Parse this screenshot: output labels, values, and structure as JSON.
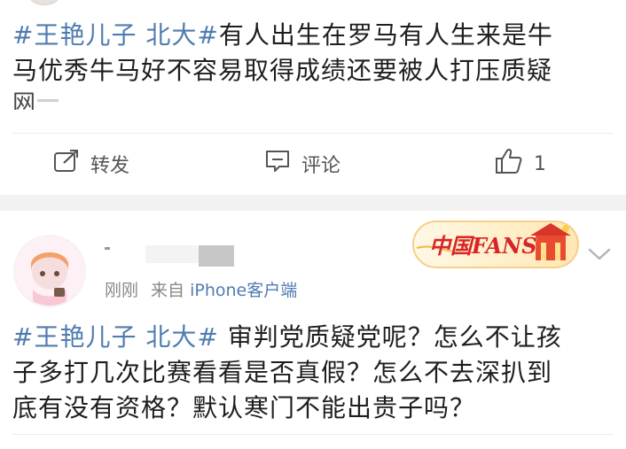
{
  "post_top": {
    "hashtag": "#王艳儿子 北大#",
    "line1_rest": "有人出生在罗马有人生来是牛",
    "line2": "马优秀牛马好不容易取得成绩还要被人打压质疑",
    "line3_cut": "网"
  },
  "actions": {
    "repost_label": "转发",
    "comment_label": "评论",
    "like_count": "1",
    "repost_icon": "repost-icon",
    "comment_icon": "comment-icon",
    "like_icon": "thumbs-up-icon"
  },
  "post_second": {
    "badge_text": "中国FANS",
    "meta_time": "刚刚",
    "meta_from": "来自",
    "meta_source": "iPhone客户端",
    "hashtag": "#王艳儿子 北大#",
    "line1_rest": " 审判党质疑党呢？怎么不让孩",
    "line2": "子多打几次比赛看看是否真假？怎么不去深扒到",
    "line3": "底有没有资格？默认寒门不能出贵子吗？"
  },
  "colors": {
    "link_blue": "#4f7cb0",
    "text_dark": "#1e1e1e",
    "meta_gray": "#8a8a8a",
    "separator_band": "#f2f2f2",
    "badge_red": "#d8232a"
  }
}
